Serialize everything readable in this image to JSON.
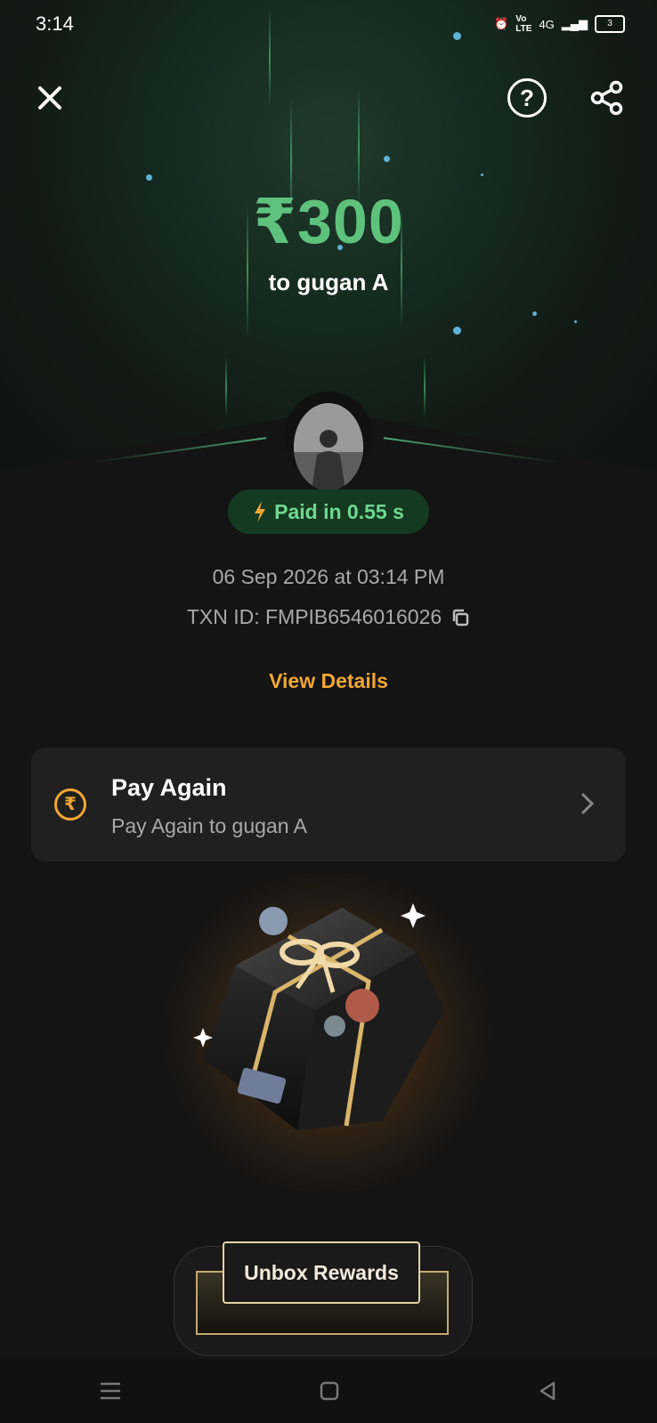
{
  "status_bar": {
    "time": "3:14",
    "network": "4G",
    "battery": "3"
  },
  "header": {
    "close_icon": "close-icon",
    "help_icon": "question-circle-icon",
    "share_icon": "share-icon"
  },
  "payment": {
    "amount": "₹300",
    "payee": "to gugan A",
    "paid_badge": "Paid in 0.55 s",
    "datetime": "06 Sep 2026 at 03:14 PM",
    "txn_id": "TXN ID: FMPIB6546016026",
    "view_details": "View Details"
  },
  "pay_again": {
    "title": "Pay Again",
    "subtitle": "Pay Again to gugan A",
    "icon": "rupee-refresh-icon"
  },
  "rewards": {
    "button_label": "Unbox Rewards"
  },
  "colors": {
    "accent_green": "#5ec27d",
    "accent_orange": "#f2a634",
    "background": "#141414"
  }
}
